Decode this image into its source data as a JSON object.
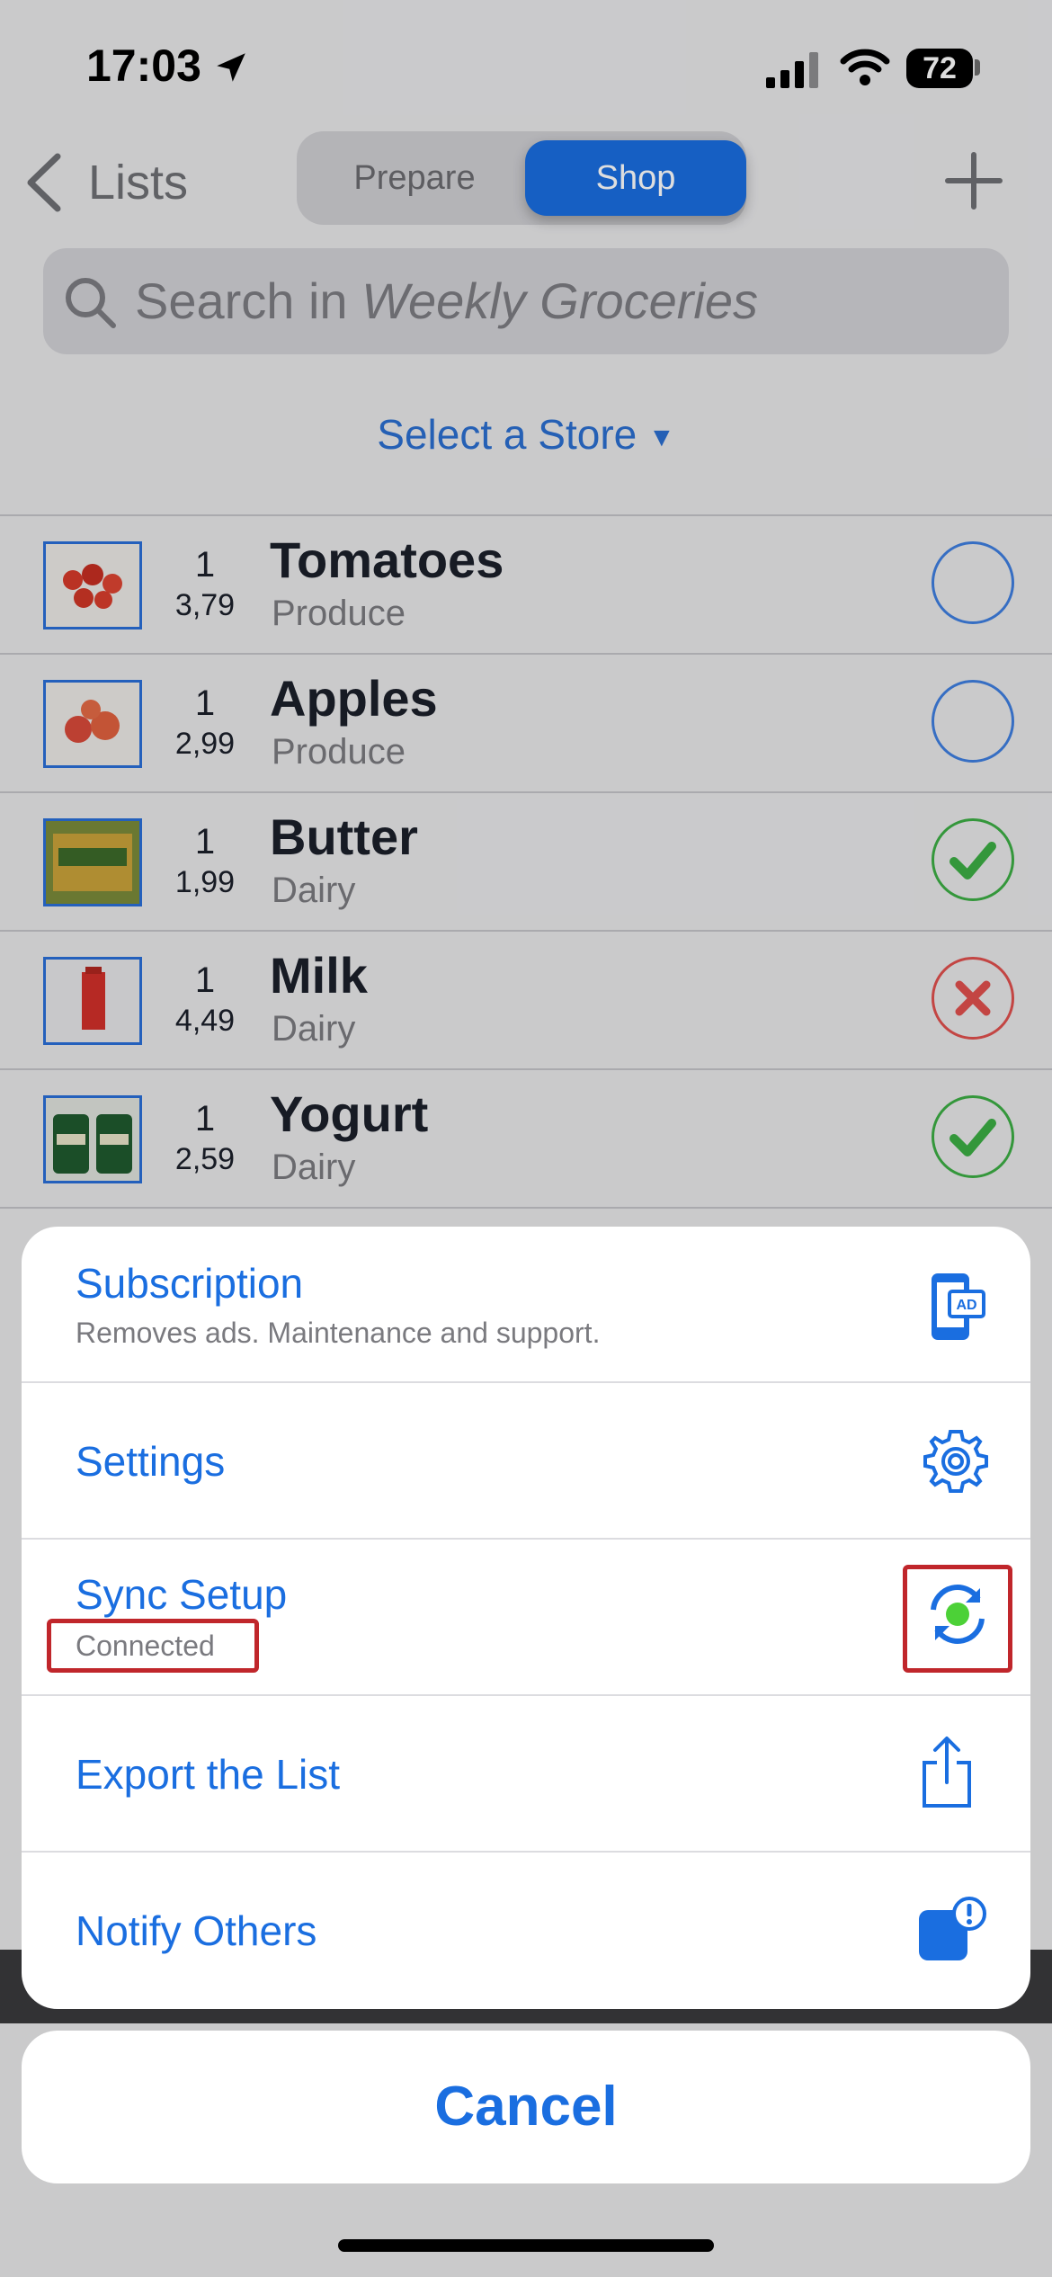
{
  "status_bar": {
    "time": "17:03",
    "battery": "72"
  },
  "nav": {
    "back_label": "Lists",
    "segments": [
      "Prepare",
      "Shop"
    ],
    "selected_segment": "Shop"
  },
  "search": {
    "prefix": "Search in ",
    "list_name": "Weekly Groceries"
  },
  "store_selector": {
    "label": "Select a Store",
    "caret": "▼"
  },
  "items": [
    {
      "qty": "1",
      "price": "3,79",
      "name": "Tomatoes",
      "category": "Produce",
      "status": "unchecked",
      "icon": "tomatoes-image"
    },
    {
      "qty": "1",
      "price": "2,99",
      "name": "Apples",
      "category": "Produce",
      "status": "unchecked",
      "icon": "apples-image"
    },
    {
      "qty": "1",
      "price": "1,99",
      "name": "Butter",
      "category": "Dairy",
      "status": "checked",
      "icon": "butter-image"
    },
    {
      "qty": "1",
      "price": "4,49",
      "name": "Milk",
      "category": "Dairy",
      "status": "cancelled",
      "icon": "milk-image"
    },
    {
      "qty": "1",
      "price": "2,59",
      "name": "Yogurt",
      "category": "Dairy",
      "status": "checked",
      "icon": "yogurt-image"
    }
  ],
  "action_sheet": {
    "items": [
      {
        "label": "Subscription",
        "sublabel": "Removes ads. Maintenance and support.",
        "icon": "subscription-ad-icon"
      },
      {
        "label": "Settings",
        "icon": "gear-icon"
      },
      {
        "label": "Sync Setup",
        "sublabel": "Connected",
        "icon": "sync-connected-icon"
      },
      {
        "label": "Export the List",
        "icon": "share-icon"
      },
      {
        "label": "Notify Others",
        "icon": "notify-icon"
      }
    ],
    "cancel_label": "Cancel"
  },
  "colors": {
    "accent": "#1a6ee0",
    "check": "#3cae44",
    "cancel": "#e0504d",
    "highlight": "#c0262b"
  }
}
